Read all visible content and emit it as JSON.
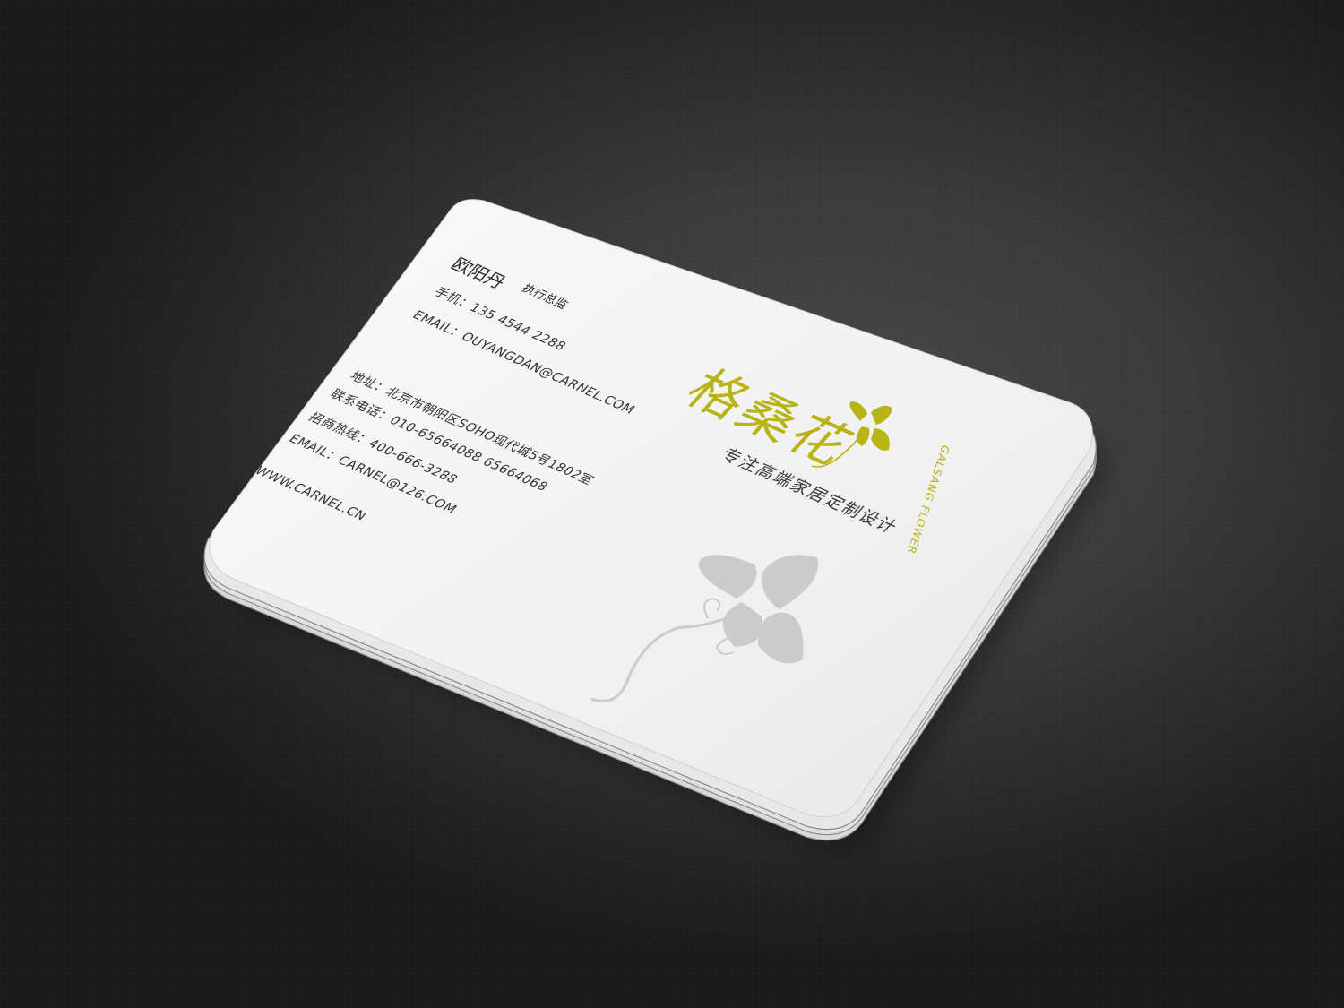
{
  "card": {
    "name": "欧阳丹",
    "title": "执行总监",
    "mobile": "手机：135 4544 2288",
    "email_personal": "EMAIL：OUYANGDAN@CARNEL.COM",
    "address": "地址：北京市朝阳区SOHO现代城5号1802室",
    "phone": "联系电话：010-65664088 65664068",
    "hotline": "招商热线：400-666-3288",
    "email_company": "EMAIL：CARNEL@126.COM",
    "website": "WWW.CARNEL.CN",
    "logo_cn": "格桑花",
    "logo_en": "GALSANG FLOWER",
    "slogan": "专注高端家居定制设计"
  },
  "colors": {
    "background": "#333333",
    "card": "#f4f4f4",
    "logo_accent": "#b8b416",
    "watermark": "#c9c9c9"
  }
}
